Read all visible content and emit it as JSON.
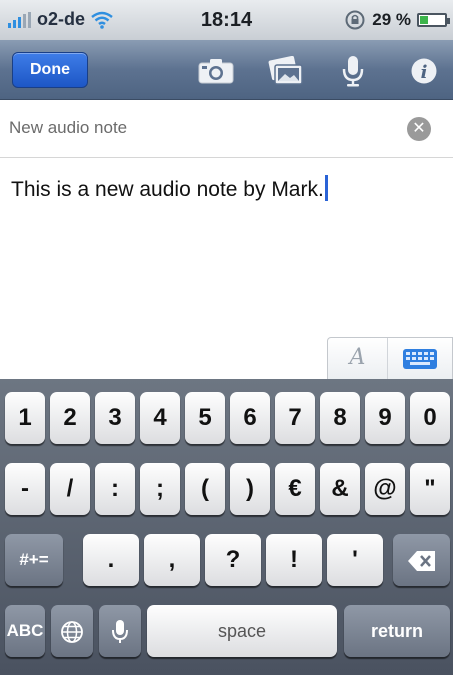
{
  "status": {
    "carrier": "o2-de",
    "time": "18:14",
    "battery_text": "29 %",
    "battery_level": 0.29
  },
  "toolbar": {
    "done_label": "Done",
    "icons": [
      "camera-icon",
      "photo-library-icon",
      "microphone-icon",
      "info-icon"
    ]
  },
  "note": {
    "title": "New audio note",
    "body": "This is a new audio note by Mark."
  },
  "format_toggle": {
    "text_style_label": "A",
    "keyboard_icon": "keyboard-icon"
  },
  "keyboard": {
    "row1": [
      "1",
      "2",
      "3",
      "4",
      "5",
      "6",
      "7",
      "8",
      "9",
      "0"
    ],
    "row2": [
      "-",
      "/",
      ":",
      ";",
      "(",
      ")",
      "€",
      "&",
      "@",
      "\""
    ],
    "row3_symbols": "#+=",
    "row3": [
      ".",
      ",",
      "?",
      "!",
      "'"
    ],
    "abc": "ABC",
    "space": "space",
    "return": "return"
  }
}
